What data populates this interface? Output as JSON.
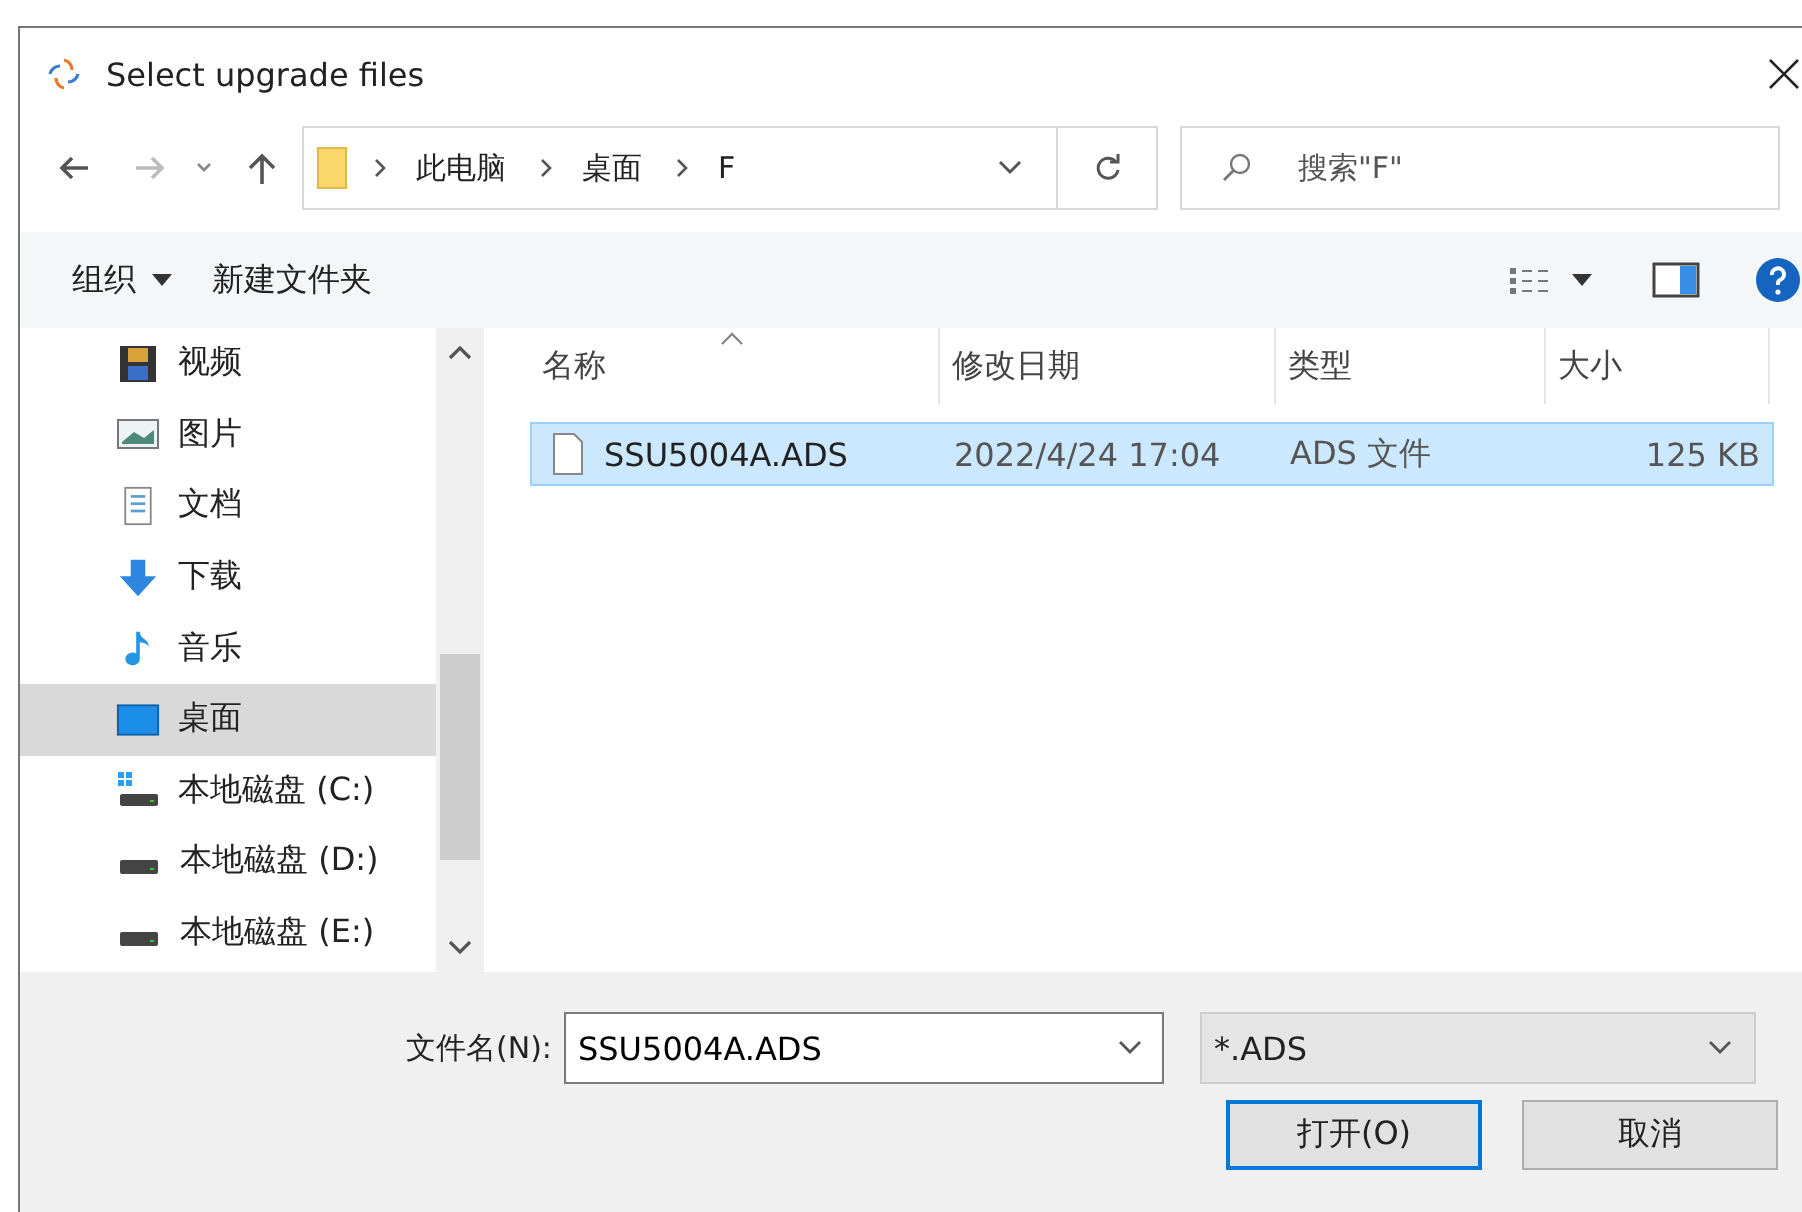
{
  "window": {
    "title": "Select upgrade files"
  },
  "address": {
    "segments": [
      "此电脑",
      "桌面",
      "F"
    ]
  },
  "search": {
    "placeholder": "搜索\"F\""
  },
  "toolbar": {
    "organize": "组织",
    "new_folder": "新建文件夹"
  },
  "sidebar": {
    "items": [
      {
        "label": "视频",
        "kind": "video",
        "selected": false
      },
      {
        "label": "图片",
        "kind": "picture",
        "selected": false
      },
      {
        "label": "文档",
        "kind": "document",
        "selected": false
      },
      {
        "label": "下载",
        "kind": "download",
        "selected": false
      },
      {
        "label": "音乐",
        "kind": "music",
        "selected": false
      },
      {
        "label": "桌面",
        "kind": "desktop",
        "selected": true
      },
      {
        "label": "本地磁盘 (C:)",
        "kind": "system-drive",
        "selected": false
      },
      {
        "label": "本地磁盘 (D:)",
        "kind": "drive",
        "selected": false
      },
      {
        "label": "本地磁盘 (E:)",
        "kind": "drive",
        "selected": false
      }
    ]
  },
  "table": {
    "columns": [
      "名称",
      "修改日期",
      "类型",
      "大小"
    ],
    "rows": [
      {
        "name": "SSU5004A.ADS",
        "modified": "2022/4/24 17:04",
        "type": "ADS 文件",
        "size": "125 KB",
        "selected": true
      }
    ]
  },
  "footer": {
    "filename_label": "文件名(N):",
    "filename": "SSU5004A.ADS",
    "filter": "*.ADS",
    "open": "打开(O)",
    "cancel": "取消"
  }
}
